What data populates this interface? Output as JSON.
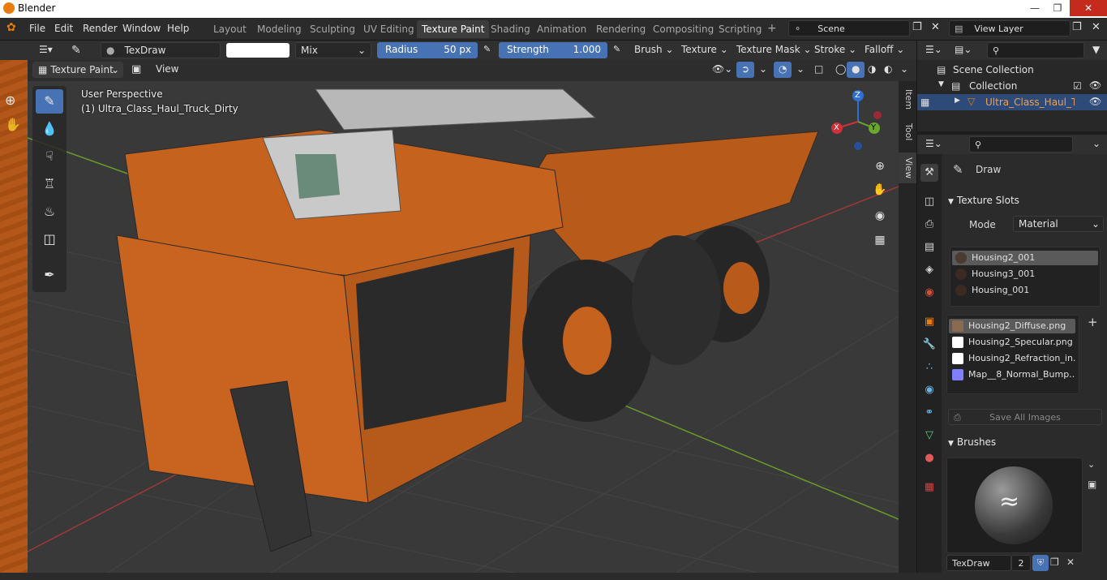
{
  "window": {
    "title": "Blender"
  },
  "menu": [
    "File",
    "Edit",
    "Render",
    "Window",
    "Help"
  ],
  "workspaces": [
    "Layout",
    "Modeling",
    "Sculpting",
    "UV Editing",
    "Texture Paint",
    "Shading",
    "Animation",
    "Rendering",
    "Compositing",
    "Scripting"
  ],
  "active_workspace": "Texture Paint",
  "scene_name": "Scene",
  "view_layer": "View Layer",
  "tool_header": {
    "brush_name": "TexDraw",
    "blend_mode": "Mix",
    "radius_label": "Radius",
    "radius_value": "50 px",
    "strength_label": "Strength",
    "strength_value": "1.000",
    "strength_fraction": 1.0,
    "menus": [
      "Brush",
      "Texture",
      "Texture Mask",
      "Stroke",
      "Falloff"
    ]
  },
  "viewport_header": {
    "mode": "Texture Paint",
    "view_label": "View"
  },
  "viewport": {
    "perspective": "User Perspective",
    "object_label": "(1) Ultra_Class_Haul_Truck_Dirty"
  },
  "gizmo": {
    "z": "Z",
    "y": "Y",
    "x": "X"
  },
  "side_tabs": [
    "Item",
    "Tool",
    "View"
  ],
  "outliner": {
    "root": "Scene Collection",
    "collection": "Collection",
    "object": "Ultra_Class_Haul_Tru"
  },
  "properties": {
    "tool_name": "Draw",
    "texture_slots_title": "Texture Slots",
    "mode_label": "Mode",
    "mode_value": "Material",
    "materials": [
      "Housing2_001",
      "Housing3_001",
      "Housing_001"
    ],
    "images": [
      {
        "name": "Housing2_Diffuse.png",
        "color": "#8a6a50"
      },
      {
        "name": "Housing2_Specular.png",
        "color": "#ffffff"
      },
      {
        "name": "Housing2_Refraction_in...",
        "color": "#ffffff"
      },
      {
        "name": "Map__8_Normal_Bump....",
        "color": "#8080ff"
      }
    ],
    "save_all": "Save All Images",
    "brushes_title": "Brushes",
    "brush_name": "TexDraw",
    "brush_users": "2"
  },
  "colors": {
    "accent": "#4772b3",
    "orange": "#e87d0d",
    "panel": "#2b2b2b"
  }
}
